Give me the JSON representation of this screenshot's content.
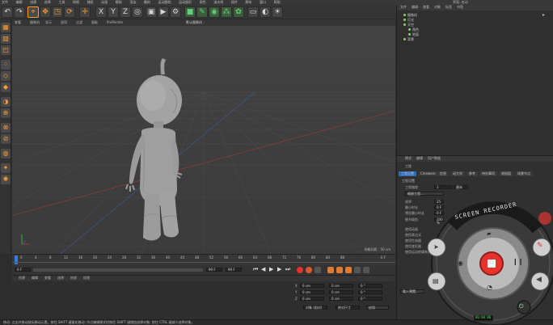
{
  "app": {
    "menu": [
      "文件",
      "编辑",
      "创建",
      "选择",
      "工具",
      "网格",
      "捕捉",
      "动画",
      "模拟",
      "渲染",
      "雕刻",
      "运动跟踪",
      "运动图形",
      "角色",
      "流水线",
      "插件",
      "脚本",
      "窗口",
      "帮助"
    ],
    "layout_label": "界面: 启动"
  },
  "viewport": {
    "menu": [
      "查看",
      "摄像机",
      "显示",
      "选项",
      "过滤",
      "面板",
      "ProRender"
    ],
    "title": "默认摄像机 ◦",
    "grid_info": "网格间距 : 50 cm"
  },
  "objects": {
    "menu": [
      "文件",
      "编辑",
      "查看",
      "对象",
      "标签",
      "书签"
    ],
    "rows": [
      {
        "name": "摄像机"
      },
      {
        "name": "灯光"
      },
      {
        "name": "天空"
      },
      {
        "name": "角色"
      },
      {
        "name": "地面"
      },
      {
        "name": "背景"
      }
    ]
  },
  "attributes": {
    "menu": [
      "模式",
      "编辑",
      "用户数据"
    ],
    "title": "工程",
    "tabs": [
      "工程设置",
      "Cineware",
      "信息",
      "动力学",
      "参考",
      "待办事项",
      "帧插值",
      "场景节点"
    ],
    "section": "工程设置",
    "rows": [
      {
        "label": "工程缩放",
        "value": "1",
        "unit": "厘米"
      },
      {
        "label": "帧率",
        "value": "25"
      },
      {
        "label": "最小时长",
        "value": "0 F"
      },
      {
        "label": "预览最小时长",
        "value": "0 F"
      },
      {
        "label": "细节级别",
        "value": "100 %"
      },
      {
        "label": "使用动画",
        "value": ""
      },
      {
        "label": "使用表达式",
        "value": ""
      },
      {
        "label": "使用生成器",
        "value": ""
      },
      {
        "label": "使用变形器",
        "value": ""
      },
      {
        "label": "使用运动剪辑系统",
        "value": ""
      }
    ],
    "buttons": [
      "缩放工程...",
      "载入预置..."
    ]
  },
  "timeline": {
    "ticks": [
      "0",
      "4",
      "8",
      "12",
      "16",
      "20",
      "24",
      "28",
      "32",
      "36",
      "40",
      "44",
      "48",
      "52",
      "56",
      "60",
      "64",
      "68",
      "72",
      "76",
      "80",
      "84",
      "88"
    ],
    "current_frame": "0 F",
    "start": "0 F",
    "end": "90 F",
    "end2": "90 F"
  },
  "coords": {
    "menu": [
      "创建",
      "编辑",
      "查看",
      "选择",
      "材质",
      "纹理"
    ],
    "axes": [
      "X",
      "Y",
      "Z"
    ],
    "pos": [
      "0 cm",
      "0 cm",
      "0 cm"
    ],
    "size": [
      "0 cm",
      "0 cm",
      "0 cm"
    ],
    "rot": [
      "0 °",
      "0 °",
      "0 °"
    ],
    "mode1": "对象 (相对)",
    "mode2": "绝对尺寸",
    "apply": "应用"
  },
  "status": {
    "text": "移动: 点击并拖动鼠标移动元素。按住 SHIFT 键量化移动; 节点编辑模式时按住 SHIFT 键增加选择对象; 按住 CTRL 键减少选择对象。"
  },
  "recorder": {
    "title": "SCREEN RECORDER",
    "timer": "00:00:00"
  },
  "colors": {
    "accent": "#ff9a2e",
    "record_red": "#e8322e",
    "x_axis": "#c0392b",
    "z_axis": "#2f6fd0",
    "y_axis": "#2ecc40"
  }
}
